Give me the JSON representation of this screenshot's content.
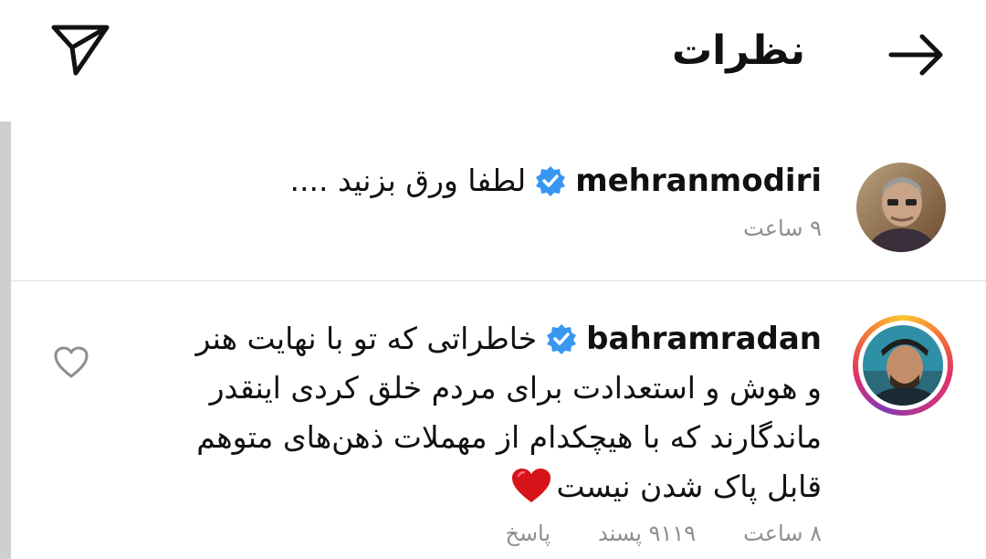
{
  "header": {
    "title": "نظرات",
    "back_icon": "arrow-right-icon",
    "send_icon": "send-icon"
  },
  "caption": {
    "username": "mehranmodiri",
    "verified": true,
    "text": "لطفا ورق بزنید ....",
    "time": "۹ ساعت"
  },
  "comment": {
    "username": "bahramradan",
    "verified": true,
    "has_story": true,
    "lines": [
      "خاطراتی که تو با نهایت هنر",
      "و هوش و استعدادت برای مردم خلق کردی اینقدر",
      "ماندگارند که با هیچکدام از مهملات ذهن‌های متوهم",
      "قابل پاک شدن نیست"
    ],
    "emoji": "red-heart",
    "time": "۸ ساعت",
    "likes": "۹۱۱۹ پسند",
    "reply_label": "پاسخ"
  },
  "colors": {
    "verified": "#3897f0",
    "meta": "#8e8e8e",
    "heart": "#d7141a"
  }
}
